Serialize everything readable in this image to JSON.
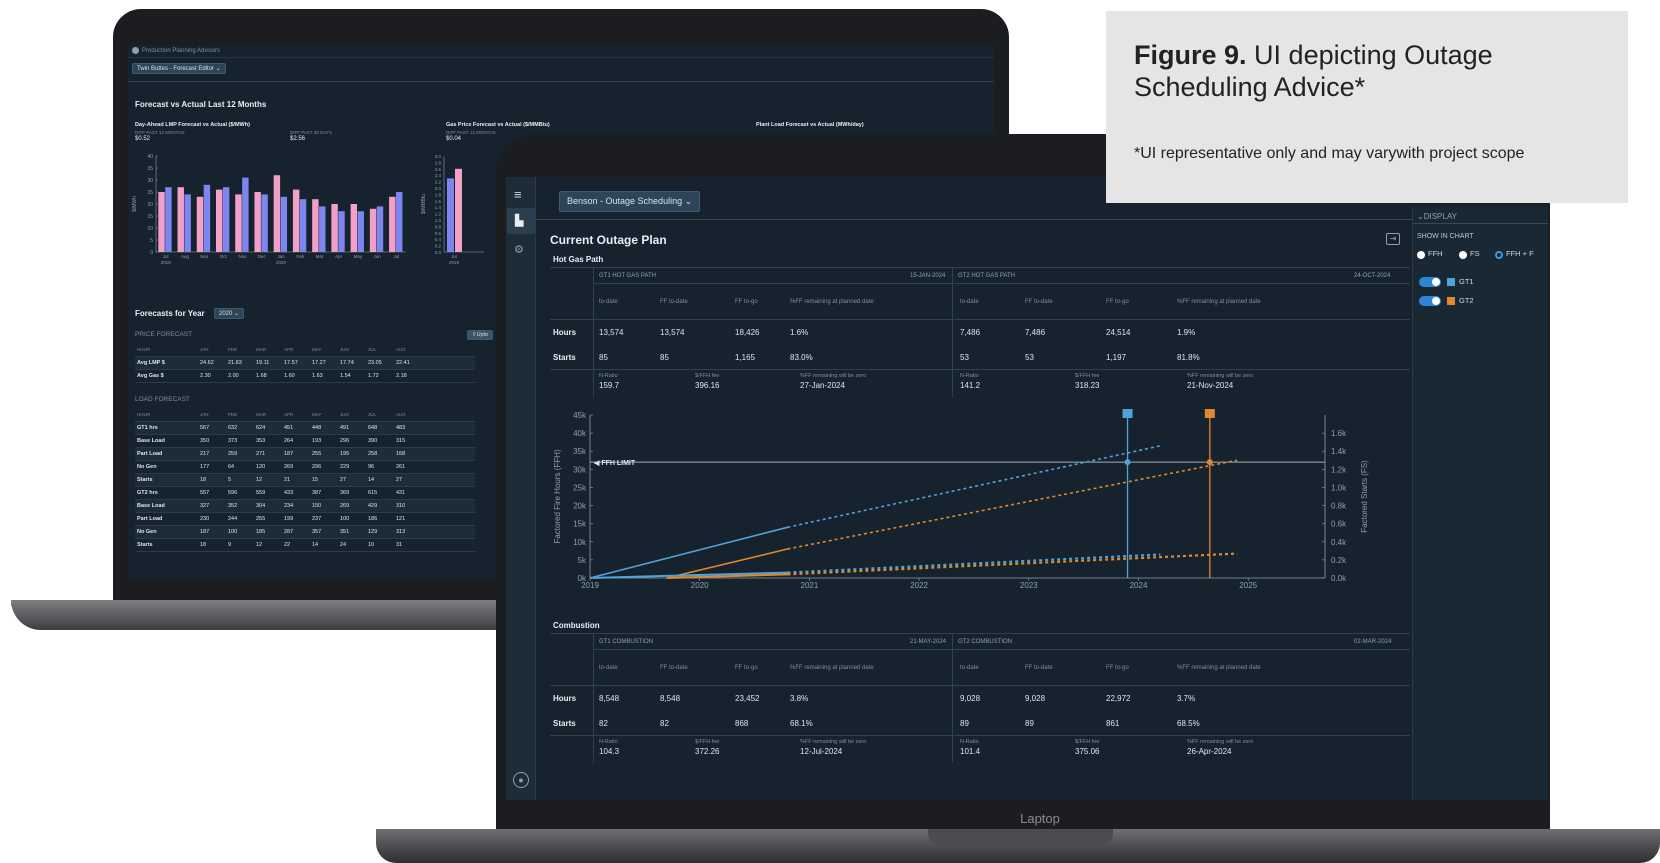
{
  "figure": {
    "label": "Figure 9.",
    "title": "UI depicting Outage Scheduling Advice*",
    "note": "*UI representative only and may varywith project scope",
    "laptop_label": "Laptop"
  },
  "back_app": {
    "app_name": "Production Planning Advisors",
    "dropdown": "Twin Buttes - Forecast Editor",
    "section_title": "Forecast vs Actual Last 12 Months",
    "panels": [
      {
        "title": "Day-Ahead LMP Forecast vs Actual ($/MWh)",
        "stat1_label": "DIFF PAST 12 MONTHS",
        "stat1": "$0.52",
        "stat2_label": "DIFF PAST 30 DAYS",
        "stat2": "$2.56"
      },
      {
        "title": "Gas Price Forecast vs Actual ($/MMBtu)",
        "stat1_label": "DIFF PAST 12 MONTHS",
        "stat1": "$0.04"
      },
      {
        "title": "Plant Load Forecast vs Actual (MWh/day)"
      }
    ],
    "chart_data": [
      {
        "type": "bar",
        "title": "Day-Ahead LMP Forecast vs Actual ($/MWh)",
        "ylabel": "$/MWh",
        "ylim": [
          0,
          40
        ],
        "yticks": [
          "40",
          "35",
          "30",
          "25",
          "20",
          "15",
          "10",
          "5",
          "0"
        ],
        "categories": [
          "Jul",
          "Aug",
          "Sep",
          "Oct",
          "Nov",
          "Dec",
          "Jan",
          "Feb",
          "Mar",
          "Apr",
          "May",
          "Jun",
          "Jul"
        ],
        "year_labels": [
          "2019",
          "2020"
        ],
        "series": [
          {
            "values": [
              25,
              27,
              23,
              26,
              24,
              25,
              32,
              26,
              22,
              20,
              20,
              18,
              23
            ],
            "color": "#f2a0c8"
          },
          {
            "values": [
              27,
              24,
              28,
              27,
              31,
              24,
              23,
              22,
              19,
              17,
              17,
              19,
              25
            ],
            "color": "#7d86ef"
          }
        ]
      },
      {
        "type": "bar",
        "title": "Gas Price Forecast vs Actual ($/MMBtu)",
        "ylabel": "$/MMBtu",
        "ylim": [
          0,
          3.0
        ],
        "yticks": [
          "3.0",
          "2.8",
          "2.6",
          "2.4",
          "2.2",
          "2.0",
          "1.8",
          "1.6",
          "1.4",
          "1.2",
          "1.0",
          "0.8",
          "0.6",
          "0.4",
          "0.2",
          "0.0"
        ],
        "categories": [
          "Jul"
        ],
        "year_labels": [
          "2019"
        ],
        "series": [
          {
            "values": [
              2.3
            ],
            "color": "#7d86ef"
          },
          {
            "values": [
              2.6
            ],
            "color": "#f2a0c8"
          }
        ]
      }
    ],
    "forecasts_title": "Forecasts for Year",
    "year": "2020",
    "upload_label": "Uplo",
    "price_forecast_label": "PRICE FORECAST",
    "load_forecast_label": "LOAD FORECAST",
    "price_header": [
      "HOUR",
      "JAN",
      "FEB",
      "MAR",
      "APR",
      "MAY",
      "JUN",
      "JUL",
      "AUG"
    ],
    "price_rows": [
      [
        "Avg LMP $",
        "24.62",
        "21.83",
        "19.11",
        "17.57",
        "17.27",
        "17.74",
        "23.05",
        "22.41"
      ],
      [
        "Avg Gas $",
        "2.30",
        "2.00",
        "1.68",
        "1.60",
        "1.63",
        "1.54",
        "1.72",
        "2.18"
      ]
    ],
    "load_header": [
      "HOUR",
      "JAN",
      "FEB",
      "MAR",
      "APR",
      "MAY",
      "JUN",
      "JUL",
      "AUG"
    ],
    "load_rows": [
      [
        "GT1 hrs",
        "567",
        "632",
        "624",
        "451",
        "448",
        "491",
        "648",
        "483"
      ],
      [
        "Base Load",
        "350",
        "373",
        "353",
        "264",
        "193",
        "296",
        "390",
        "315"
      ],
      [
        "Part Load",
        "217",
        "259",
        "271",
        "187",
        "255",
        "195",
        "258",
        "168"
      ],
      [
        "No Gen",
        "177",
        "64",
        "120",
        "269",
        "296",
        "229",
        "96",
        "261"
      ],
      [
        "Starts",
        "18",
        "5",
        "12",
        "21",
        "15",
        "27",
        "14",
        "27"
      ],
      [
        "GT2 hrs",
        "557",
        "596",
        "559",
        "433",
        "387",
        "369",
        "615",
        "431"
      ],
      [
        "Base Load",
        "327",
        "352",
        "304",
        "234",
        "150",
        "269",
        "429",
        "310"
      ],
      [
        "Part Load",
        "230",
        "244",
        "255",
        "199",
        "237",
        "100",
        "186",
        "121"
      ],
      [
        "No Gen",
        "187",
        "100",
        "185",
        "287",
        "357",
        "351",
        "129",
        "313"
      ],
      [
        "Starts",
        "18",
        "9",
        "12",
        "22",
        "14",
        "24",
        "10",
        "31"
      ]
    ]
  },
  "front_app": {
    "dropdown": "Benson - Outage Scheduling",
    "page_title": "Current Outage Plan",
    "hot_gas_path": {
      "title": "Hot Gas Path",
      "gt1_label": "GT1 HOT GAS PATH",
      "gt1_date": "15-JAN-2024",
      "gt2_label": "GT2 HOT GAS PATH",
      "gt2_date": "24-OCT-2024",
      "columns": [
        "to-date",
        "FF to-date",
        "FF to-go",
        "%FF remaining at planned date"
      ],
      "rows": [
        {
          "label": "Hours",
          "gt1": [
            "13,574",
            "13,574",
            "18,426",
            "1.6%"
          ],
          "gt2": [
            "7,486",
            "7,486",
            "24,514",
            "1.9%"
          ]
        },
        {
          "label": "Starts",
          "gt1": [
            "85",
            "85",
            "1,165",
            "83.0%"
          ],
          "gt2": [
            "53",
            "53",
            "1,197",
            "81.8%"
          ]
        }
      ],
      "sub_labels": [
        "N-Ratio",
        "$/FFH fee",
        "%FF remaining will be zero"
      ],
      "gt1_sub": [
        "159.7",
        "396.16",
        "27-Jan-2024"
      ],
      "gt2_sub": [
        "141.2",
        "318.23",
        "21-Nov-2024"
      ]
    },
    "chart_data": {
      "type": "line",
      "title": "",
      "ylabel": "Factored Fire Hours (FFH)",
      "y2label": "Factored Starts (FS)",
      "ylim": [
        0,
        45000
      ],
      "y2lim": [
        0,
        1800
      ],
      "yticks": [
        "45k",
        "40k",
        "35k",
        "30k",
        "25k",
        "20k",
        "15k",
        "10k",
        "5k",
        "0k"
      ],
      "y2ticks": [
        "1.6k",
        "1.4k",
        "1.2k",
        "1.0k",
        "0.8k",
        "0.6k",
        "0.4k",
        "0.2k",
        "0.0k"
      ],
      "x": [
        "2019",
        "2020",
        "2021",
        "2022",
        "2023",
        "2024",
        "2025"
      ],
      "ffh_limit": 32000,
      "ffh_limit_label": "FFH LIMIT",
      "series": [
        {
          "name": "GT1",
          "color": "#4fa3d8",
          "points": [
            [
              2019.0,
              0
            ],
            [
              2020.8,
              14000
            ]
          ],
          "forecast": [
            [
              2020.8,
              14000
            ],
            [
              2024.2,
              36500
            ]
          ]
        },
        {
          "name": "GT2",
          "color": "#e0882a",
          "points": [
            [
              2019.7,
              0
            ],
            [
              2020.8,
              8000
            ]
          ],
          "forecast": [
            [
              2020.8,
              8000
            ],
            [
              2024.9,
              32500
            ]
          ]
        },
        {
          "name": "GT1 FS",
          "color": "#4fa3d8",
          "points": [
            [
              2019.0,
              0
            ],
            [
              2020.8,
              60
            ]
          ],
          "forecast": [
            [
              2020.8,
              60
            ],
            [
              2024.2,
              260
            ]
          ]
        },
        {
          "name": "GT2 FS",
          "color": "#e0882a",
          "points": [
            [
              2019.7,
              0
            ],
            [
              2020.8,
              40
            ]
          ],
          "forecast": [
            [
              2020.8,
              40
            ],
            [
              2024.9,
              270
            ]
          ]
        }
      ],
      "markers": [
        {
          "series": "GT1",
          "x": 2023.9,
          "color": "#4fa3d8"
        },
        {
          "series": "GT2",
          "x": 2024.65,
          "color": "#e0882a"
        }
      ]
    },
    "combustion": {
      "title": "Combustion",
      "gt1_label": "GT1 COMBUSTION",
      "gt1_date": "21-MAY-2024",
      "gt2_label": "GT2 COMBUSTION",
      "gt2_date": "02-MAR-2024",
      "columns": [
        "to-date",
        "FF to-date",
        "FF to-go",
        "%FF remaining at planned date"
      ],
      "rows": [
        {
          "label": "Hours",
          "gt1": [
            "8,548",
            "8,548",
            "23,452",
            "3.8%"
          ],
          "gt2": [
            "9,028",
            "9,028",
            "22,972",
            "3.7%"
          ]
        },
        {
          "label": "Starts",
          "gt1": [
            "82",
            "82",
            "868",
            "68.1%"
          ],
          "gt2": [
            "89",
            "89",
            "861",
            "68.5%"
          ]
        }
      ],
      "sub_labels": [
        "N-Ratio",
        "$/FFH fee",
        "%FF remaining will be zero"
      ],
      "gt1_sub": [
        "104.3",
        "372.26",
        "12-Jul-2024"
      ],
      "gt2_sub": [
        "101.4",
        "375.06",
        "26-Apr-2024"
      ]
    },
    "display": {
      "title": "DISPLAY",
      "show_in_chart": "SHOW IN CHART",
      "radio_options": [
        "FFH",
        "FS",
        "FFH + F"
      ],
      "selected": "FFH + F",
      "toggles": [
        {
          "label": "GT1",
          "color": "#4fa3d8"
        },
        {
          "label": "GT2",
          "color": "#e0882a"
        }
      ]
    }
  }
}
